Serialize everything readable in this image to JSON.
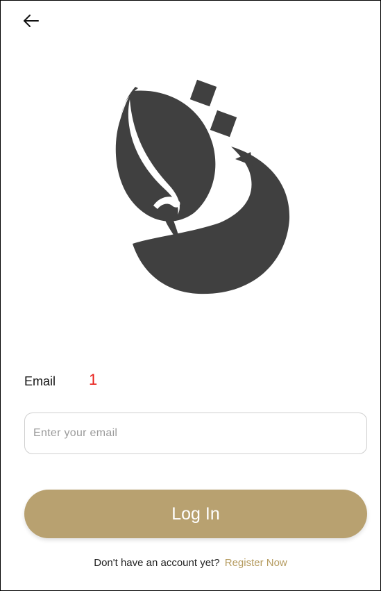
{
  "header": {
    "back_icon": "arrow-left-icon"
  },
  "logo": {
    "icon": "calligraphy-logo",
    "color": "#404040"
  },
  "form": {
    "email_label": "Email",
    "annotation": "1",
    "email_value": "",
    "email_placeholder": "Enter your email"
  },
  "actions": {
    "login_label": "Log In",
    "login_color": "#b8a170"
  },
  "footer": {
    "prompt": "Don't have an account yet?",
    "register_label": "Register Now",
    "register_color": "#b59b5f"
  }
}
